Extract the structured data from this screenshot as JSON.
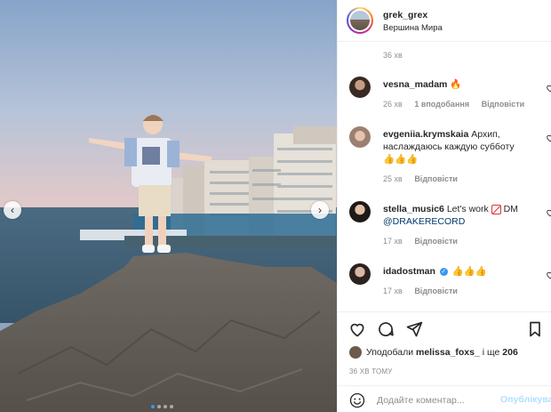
{
  "post": {
    "username": "grek_grex",
    "location": "Вершина Мира",
    "caption_time": "36 хв",
    "likes_prefix": "Уподобали",
    "likes_user": "melissa_foxs_",
    "likes_and": "і ще",
    "likes_count": "206",
    "posted_ago": "36 ХВ ТОМУ"
  },
  "nav": {
    "prev_icon": "chevron-left-icon",
    "next_icon": "chevron-right-icon"
  },
  "carousel": {
    "dots": 4,
    "active_index": 0
  },
  "comments": [
    {
      "username": "vesna_madam",
      "text": "",
      "emoji": "🔥",
      "time": "26 хв",
      "likes": "1 вподобання",
      "reply": "Відповісти"
    },
    {
      "username": "evgeniia.krymskaia",
      "text": "Архип, наслаждаюсь каждую субботу",
      "emoji": "👍👍👍",
      "time": "25 хв",
      "reply": "Відповісти"
    },
    {
      "username": "stella_music6",
      "text_before": "Let's work",
      "text_after": "DM",
      "mention": "@DRAKERECORD",
      "time": "17 хв",
      "reply": "Відповісти"
    },
    {
      "username": "idadostman",
      "emoji": "👍👍👍",
      "time": "17 хв",
      "reply": "Відповісти"
    }
  ],
  "composer": {
    "placeholder": "Додайте коментар...",
    "publish_label": "Опублікувати"
  },
  "colors": {
    "accent": "#3897f0",
    "link": "#00376b",
    "muted": "#8e8e8e",
    "publish_disabled": "#b2dffc"
  }
}
